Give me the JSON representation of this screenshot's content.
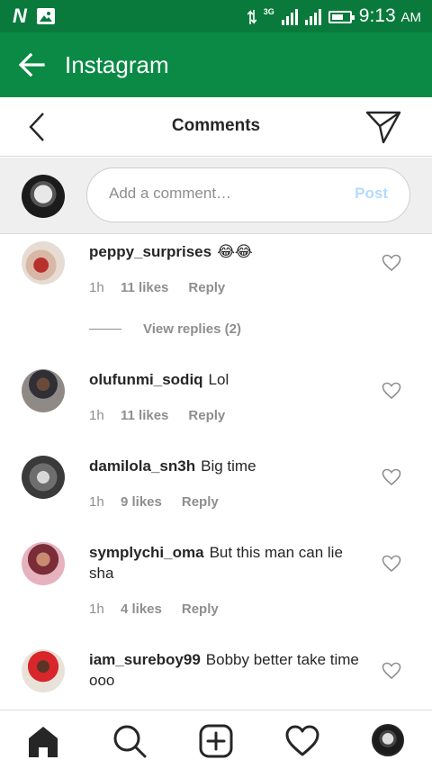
{
  "status_bar": {
    "network_label": "3G",
    "time": "9:13",
    "ampm": "AM"
  },
  "app_bar": {
    "title": "Instagram"
  },
  "comments_header": {
    "title": "Comments"
  },
  "add_comment": {
    "placeholder": "Add a comment…",
    "post_label": "Post"
  },
  "comments": [
    {
      "username": "peppy_surprises",
      "text": "😂😂",
      "time": "1h",
      "likes": "11 likes",
      "reply_label": "Reply",
      "view_replies": "View replies (2)"
    },
    {
      "username": "olufunmi_sodiq",
      "text": "Lol",
      "time": "1h",
      "likes": "11 likes",
      "reply_label": "Reply"
    },
    {
      "username": "damilola_sn3h",
      "text": "Big time",
      "time": "1h",
      "likes": "9 likes",
      "reply_label": "Reply"
    },
    {
      "username": "symplychi_oma",
      "text": "But this man can lie sha",
      "time": "1h",
      "likes": "4 likes",
      "reply_label": "Reply"
    },
    {
      "username": "iam_sureboy99",
      "text": "Bobby better take time ooo",
      "time": "",
      "likes": "",
      "reply_label": ""
    }
  ],
  "bottom_nav": {
    "items": [
      "home-icon",
      "search-icon",
      "add-post-icon",
      "activity-heart-icon",
      "profile-avatar"
    ]
  },
  "colors": {
    "status_bar_bg": "#0a7a3c",
    "app_bar_bg": "#0b8a45",
    "post_disabled": "#b3dbff",
    "meta_gray": "#8e8e8e"
  }
}
